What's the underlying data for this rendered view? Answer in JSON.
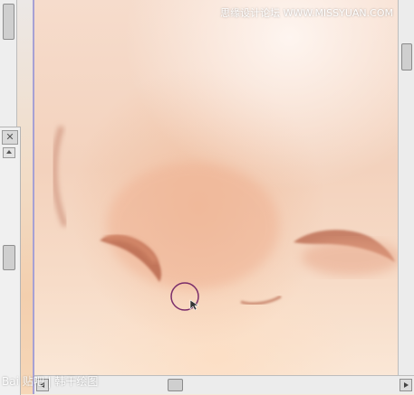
{
  "left_panel": {
    "close_label": "✕"
  },
  "canvas": {
    "subject": "nose painting",
    "brush_cursor_icon": "brush-circle-cursor-icon"
  },
  "watermark_top": {
    "text": "思缘设计论坛 WWW.MISSYUAN.COM"
  },
  "watermark_bottom": {
    "text": "Bai 贴吧 | 韩干绘图"
  },
  "colors": {
    "canvas_frame": "#a7a1d4",
    "skin_light": "#f6dccc",
    "skin_shadow": "#eeb08a",
    "nostril_stroke": "#b5644c",
    "brush_ring": "#7a2d6a"
  }
}
